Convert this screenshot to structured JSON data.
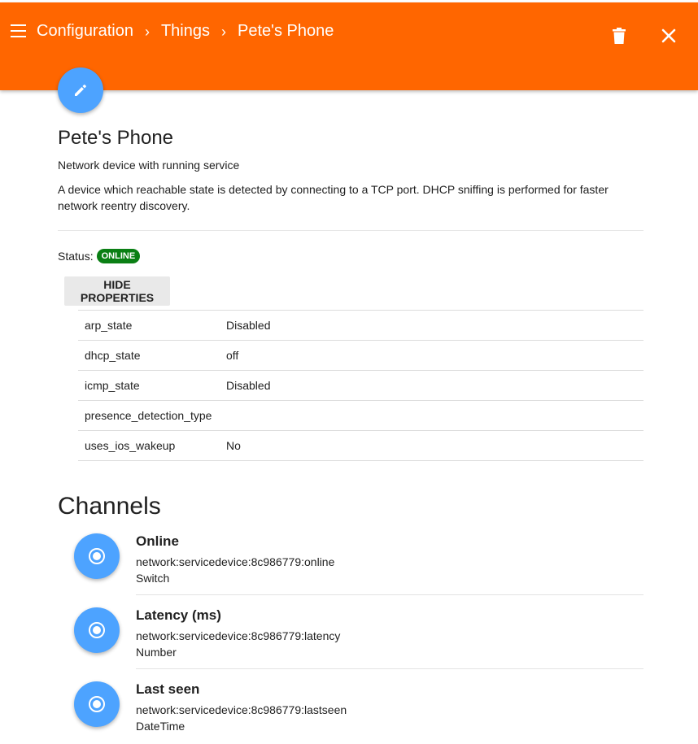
{
  "header": {
    "breadcrumb": [
      "Configuration",
      "Things",
      "Pete's Phone"
    ],
    "separator": "›"
  },
  "thing": {
    "title": "Pete's Phone",
    "type": "Network device with running service",
    "description": "A device which reachable state is detected by connecting to a TCP port. DHCP sniffing is performed for faster network reentry discovery.",
    "status_label": "Status:",
    "status": "ONLINE",
    "props_button_label": "HIDE PROPERTIES",
    "properties": [
      {
        "key": "arp_state",
        "value": "Disabled"
      },
      {
        "key": "dhcp_state",
        "value": "off"
      },
      {
        "key": "icmp_state",
        "value": "Disabled"
      },
      {
        "key": "presence_detection_type",
        "value": ""
      },
      {
        "key": "uses_ios_wakeup",
        "value": "No"
      }
    ]
  },
  "channels": {
    "title": "Channels",
    "items": [
      {
        "name": "Online",
        "uid": "network:servicedevice:8c986779:online",
        "type": "Switch"
      },
      {
        "name": "Latency (ms)",
        "uid": "network:servicedevice:8c986779:latency",
        "type": "Number"
      },
      {
        "name": "Last seen",
        "uid": "network:servicedevice:8c986779:lastseen",
        "type": "DateTime"
      }
    ]
  },
  "icons": {
    "menu": "menu-icon",
    "delete": "trash-icon",
    "close": "close-icon",
    "edit": "pencil-icon",
    "channel": "radio-button-icon"
  },
  "colors": {
    "accent": "#ff6600",
    "primary": "#4da3ff",
    "status_online": "#0a7f14"
  }
}
